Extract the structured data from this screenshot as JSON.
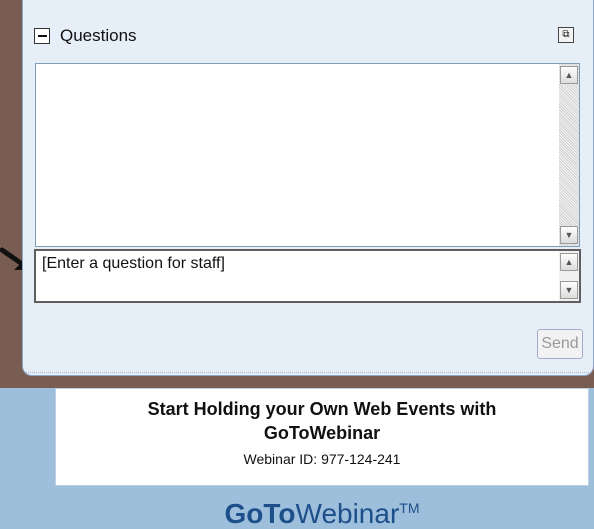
{
  "panel": {
    "title": "Questions",
    "collapse_icon": "minus-icon",
    "popout_icon": "popout-icon"
  },
  "question_input": {
    "placeholder": "[Enter a question for staff]"
  },
  "send_button": {
    "label": "Send"
  },
  "promo": {
    "headline_line1": "Start Holding your Own Web Events with",
    "headline_line2": "GoToWebinar",
    "webinar_id": "Webinar ID: 977-124-241"
  },
  "logo": {
    "bold": "GoTo",
    "regular": "Webinar",
    "tm": "TM"
  },
  "colors": {
    "brown_bg": "#7a5d52",
    "panel_bg": "#e6eef7",
    "logo_blue": "#1d4f8a"
  }
}
